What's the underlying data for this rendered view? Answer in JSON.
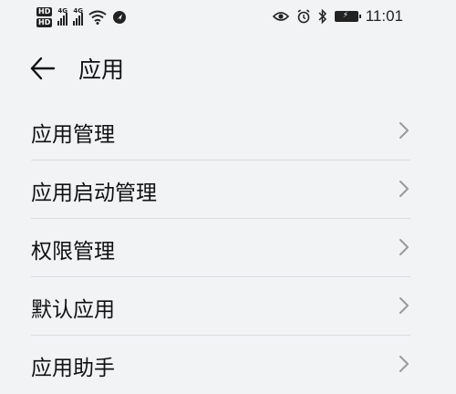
{
  "status_bar": {
    "time": "11:01",
    "sim1_badge": "HD",
    "sim2_badge": "HD",
    "sim1_net": "4G",
    "sim2_net": "4G",
    "icons": [
      "hd-icon",
      "signal-icon",
      "wifi-icon",
      "location-icon",
      "eye-icon",
      "alarm-icon",
      "bluetooth-icon",
      "battery-icon"
    ]
  },
  "header": {
    "title": "应用",
    "back_icon": "arrow-left-icon"
  },
  "list": {
    "items": [
      {
        "label": "应用管理"
      },
      {
        "label": "应用启动管理"
      },
      {
        "label": "权限管理"
      },
      {
        "label": "默认应用"
      },
      {
        "label": "应用助手"
      }
    ]
  },
  "colors": {
    "background": "#f1f3f5",
    "text": "#111111",
    "chevron": "#9a9a9a",
    "divider": "#dcdcdc"
  }
}
